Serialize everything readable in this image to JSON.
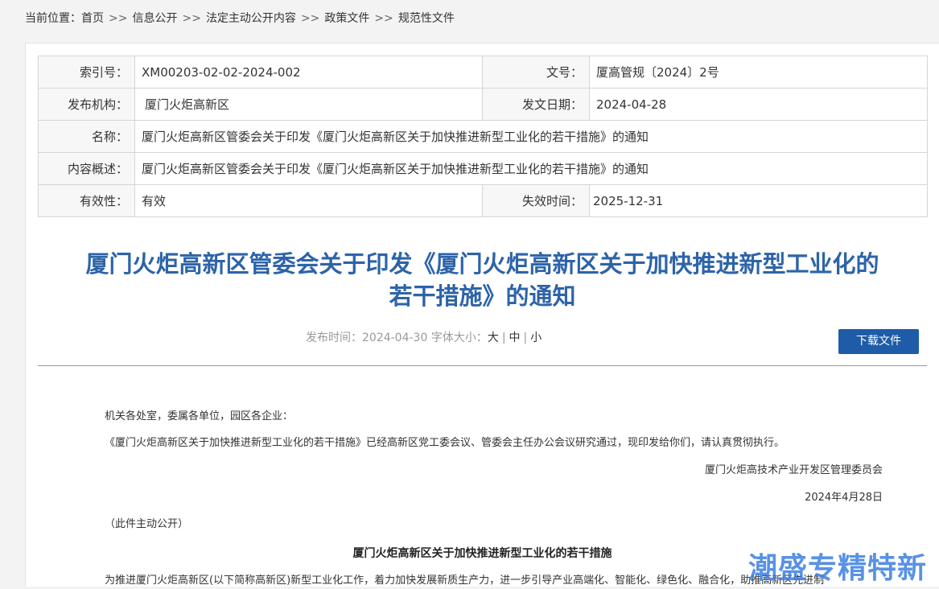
{
  "breadcrumb": {
    "prefix": "当前位置：",
    "items": [
      "首页",
      "信息公开",
      "法定主动公开内容",
      "政策文件",
      "规范性文件"
    ],
    "separator": ">>"
  },
  "meta": {
    "index_label": "索引号：",
    "index_value": "XM00203-02-02-2024-002",
    "docno_label": "文号：",
    "docno_value": "厦高管规〔2024〕2号",
    "issuer_label": "发布机构：",
    "issuer_value": "厦门火炬高新区",
    "date_label": "发文日期：",
    "date_value": "2024-04-28",
    "name_label": "名称：",
    "name_value": "厦门火炬高新区管委会关于印发《厦门火炬高新区关于加快推进新型工业化的若干措施》的通知",
    "summary_label": "内容概述：",
    "summary_value": "厦门火炬高新区管委会关于印发《厦门火炬高新区关于加快推进新型工业化的若干措施》的通知",
    "validity_label": "有效性：",
    "validity_value": "有效",
    "expire_label": "失效时间：",
    "expire_value": "2025-12-31"
  },
  "article": {
    "title_line1": "厦门火炬高新区管委会关于印发《厦门火炬高新区关于加快推进新型工业化的",
    "title_line2": "若干措施》的通知",
    "pub_label": "发布时间：",
    "pub_date": "2024-04-30",
    "font_size_label": "字体大小：",
    "font_large": "大",
    "font_medium": "中",
    "font_small": "小",
    "font_bar": "|",
    "download_label": "下载文件",
    "salutation": "机关各处室，委属各单位，园区各企业：",
    "para1": "《厦门火炬高新区关于加快推进新型工业化的若干措施》已经高新区党工委会议、管委会主任办公会议研究通过，现印发给你们，请认真贯彻执行。",
    "signer": "厦门火炬高技术产业开发区管理委员会",
    "sign_date": "2024年4月28日",
    "disclosure": "（此件主动公开）",
    "attachment_title": "厦门火炬高新区关于加快推进新型工业化的若干措施",
    "para2": "为推进厦门火炬高新区(以下简称高新区)新型工业化工作，着力加快发展新质生产力，进一步引导产业高端化、智能化、绿色化、融合化，助推高新区先进制"
  },
  "watermark": "潮盛专精特新"
}
